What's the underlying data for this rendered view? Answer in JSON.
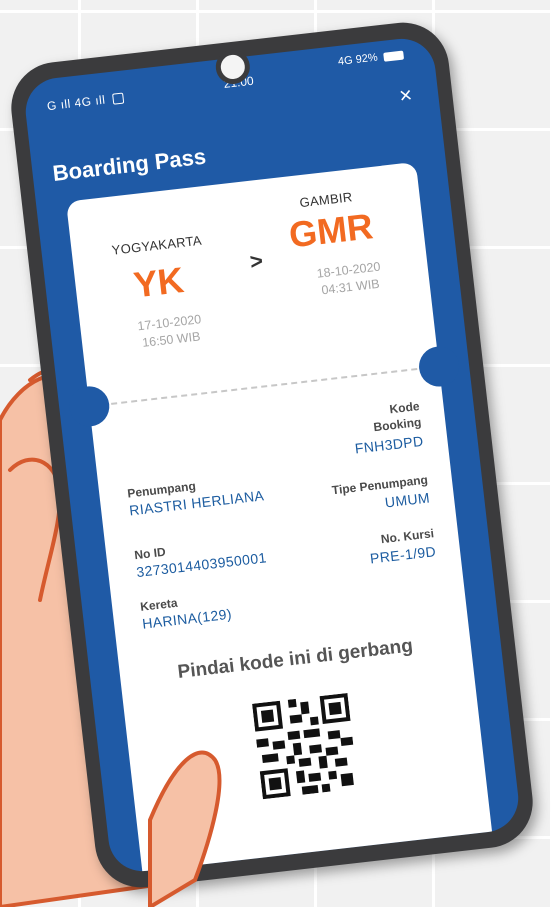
{
  "status_bar": {
    "signal_left": "G ıll 4G ıll",
    "gallery_icon": "gallery-icon",
    "time": "21:00",
    "network": "4G",
    "battery": "92%"
  },
  "header": {
    "title": "Boarding Pass",
    "close_label": "×"
  },
  "trip": {
    "origin": {
      "city": "YOGYAKARTA",
      "code": "YK",
      "date": "17-10-2020",
      "time": "16:50 WIB"
    },
    "destination": {
      "city": "GAMBIR",
      "code": "GMR",
      "date": "18-10-2020",
      "time": "04:31 WIB"
    },
    "arrow": ">"
  },
  "details": {
    "passenger_label": "Penumpang",
    "passenger_value": "RIASTRI HERLIANA",
    "id_label": "No ID",
    "id_value": "3273014403950001",
    "train_label": "Kereta",
    "train_value": "HARINA(129)",
    "booking_label_1": "Kode",
    "booking_label_2": "Booking",
    "booking_value": "FNH3DPD",
    "type_label": "Tipe Penumpang",
    "type_value": "UMUM",
    "seat_label": "No. Kursi",
    "seat_value": "PRE-1/9D"
  },
  "scan": {
    "instruction": "Pindai kode ini di gerbang"
  },
  "colors": {
    "brand_blue": "#1f5aa6",
    "accent_orange": "#f26a21",
    "value_blue": "#1c5ca0",
    "skin": "#f6c1a6",
    "hand_outline": "#d65a2e"
  }
}
